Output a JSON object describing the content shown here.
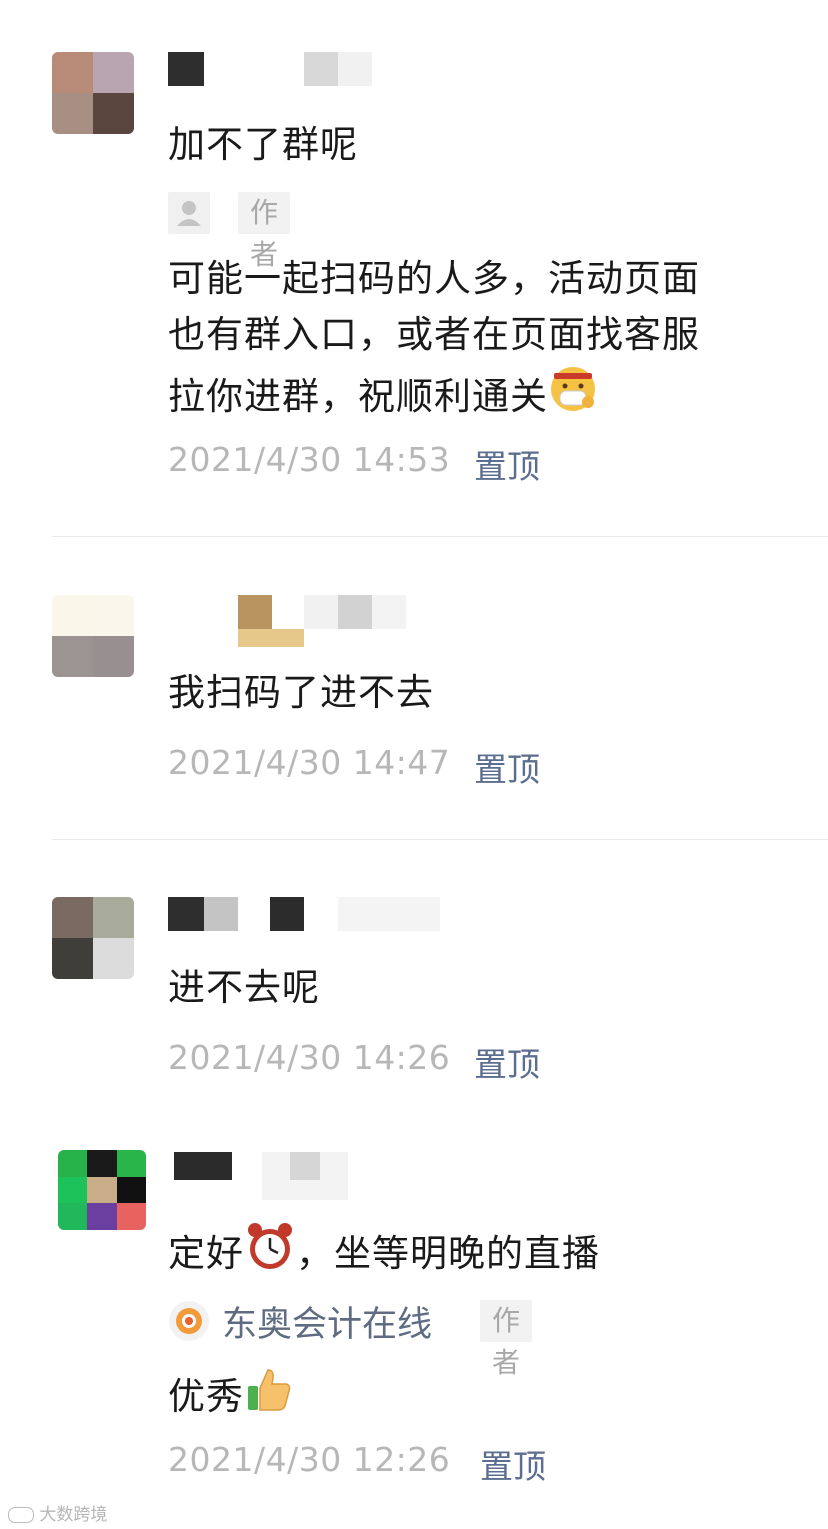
{
  "comments": [
    {
      "text": "加不了群呢",
      "reply": {
        "tag": "作者",
        "lines": [
          "可能一起扫码的人多，活动页面",
          "也有群入口，或者在页面找客服",
          "拉你进群，祝顺利通关"
        ],
        "emoji": "mask-face-icon"
      },
      "time": "2021/4/30 14:53",
      "pin": "置顶"
    },
    {
      "text": "我扫码了进不去",
      "time": "2021/4/30 14:47",
      "pin": "置顶"
    },
    {
      "text": "进不去呢",
      "time": "2021/4/30 14:26",
      "pin": "置顶"
    },
    {
      "text_before": "定好",
      "emoji": "alarm-clock-icon",
      "text_after": "，坐等明晚的直播",
      "reply": {
        "author": "东奥会计在线",
        "tag": "作者",
        "text": "优秀",
        "emoji": "thumbs-up-icon"
      },
      "time": "2021/4/30 12:26",
      "pin": "置顶"
    }
  ],
  "watermark": "大数跨境"
}
